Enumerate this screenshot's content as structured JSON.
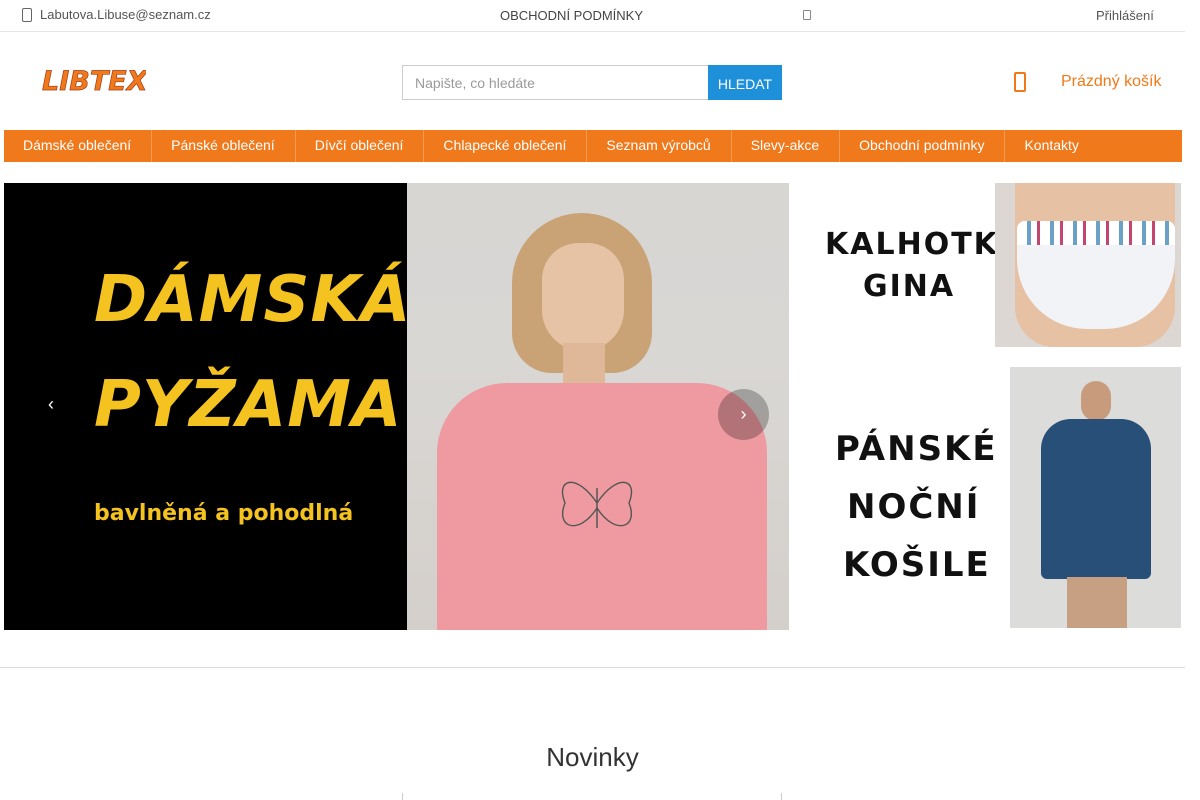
{
  "topbar": {
    "email": "Labutova.Libuse@seznam.cz",
    "terms": "OBCHODNÍ PODMÍNKY",
    "login": "Přihlášení"
  },
  "header": {
    "logo_text": "LIBTEX",
    "search": {
      "placeholder": "Napište, co hledáte",
      "button_label": "HLEDAT"
    },
    "cart_label": "Prázdný košík"
  },
  "nav": {
    "items": [
      {
        "label": "Dámské oblečení"
      },
      {
        "label": "Pánské oblečení"
      },
      {
        "label": "Dívčí oblečení"
      },
      {
        "label": "Chlapecké oblečení"
      },
      {
        "label": "Seznam výrobců"
      },
      {
        "label": "Slevy-akce"
      },
      {
        "label": "Obchodní podmínky"
      },
      {
        "label": "Kontakty"
      }
    ]
  },
  "slider": {
    "title_line1": "DÁMSKÁ",
    "title_line2": "PYŽAMA",
    "subtitle": "bavlněná a pohodlná",
    "prev_icon": "chevron-left-icon",
    "next_icon": "chevron-right-icon"
  },
  "banners": {
    "first": {
      "line1": "KALHOTKY",
      "line2": "GINA"
    },
    "second": {
      "line1": "PÁNSKÉ",
      "line2": "NOČNÍ",
      "line3": "KOŠILE"
    }
  },
  "section": {
    "title": "Novinky"
  },
  "colors": {
    "accent": "#f0791c",
    "search_button": "#1e8fd9",
    "slider_text": "#f4c320"
  }
}
